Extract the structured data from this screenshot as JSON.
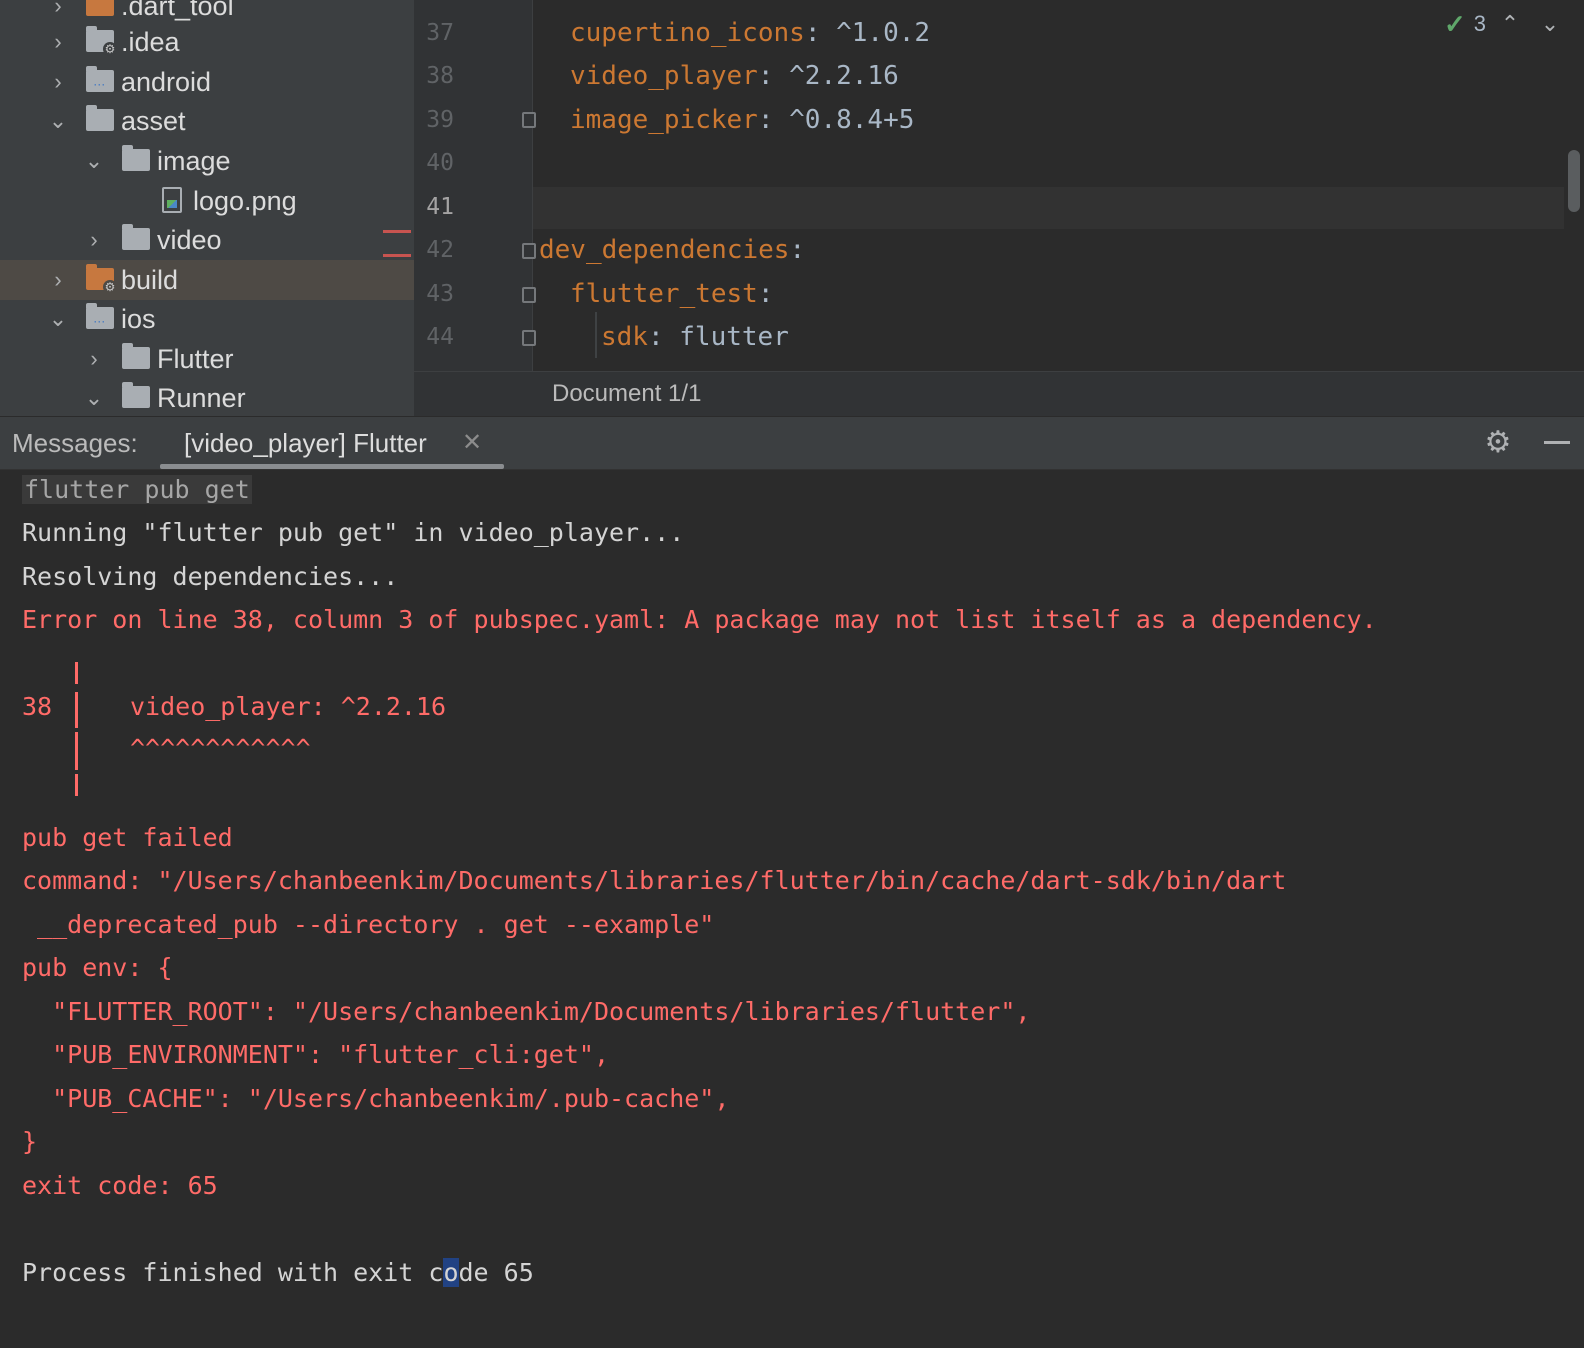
{
  "project_tree": [
    {
      "label": ".dart_tool",
      "chevron": "›",
      "depth": 0,
      "icon": "folder-orange"
    },
    {
      "label": ".idea",
      "chevron": "›",
      "depth": 0,
      "icon": "folder-settings"
    },
    {
      "label": "android",
      "chevron": "›",
      "depth": 0,
      "icon": "folder-module"
    },
    {
      "label": "asset",
      "chevron": "⌄",
      "depth": 0,
      "icon": "folder"
    },
    {
      "label": "image",
      "chevron": "⌄",
      "depth": 1,
      "icon": "folder"
    },
    {
      "label": "logo.png",
      "chevron": "",
      "depth": 2,
      "icon": "image-file"
    },
    {
      "label": "video",
      "chevron": "›",
      "depth": 1,
      "icon": "folder"
    },
    {
      "label": "build",
      "chevron": "›",
      "depth": 0,
      "icon": "folder-excluded"
    },
    {
      "label": "ios",
      "chevron": "⌄",
      "depth": 0,
      "icon": "folder-module"
    },
    {
      "label": "Flutter",
      "chevron": "›",
      "depth": 1,
      "icon": "folder"
    },
    {
      "label": "Runner",
      "chevron": "⌄",
      "depth": 1,
      "icon": "folder"
    }
  ],
  "editor": {
    "lines": [
      {
        "num": "37",
        "key": "cupertino_icons",
        "sep": ": ",
        "value": "^1.0.2"
      },
      {
        "num": "38",
        "key": "video_player",
        "sep": ": ",
        "value": "^2.2.16"
      },
      {
        "num": "39",
        "key": "image_picker",
        "sep": ": ",
        "value": "^0.8.4+5"
      },
      {
        "num": "40",
        "key": "",
        "sep": "",
        "value": ""
      },
      {
        "num": "41",
        "key": "",
        "sep": "",
        "value": ""
      },
      {
        "num": "42",
        "key": "dev_dependencies",
        "sep": ":",
        "value": ""
      },
      {
        "num": "43",
        "key": "flutter_test",
        "sep": ":",
        "value": ""
      },
      {
        "num": "44",
        "key": "sdk",
        "sep": ": ",
        "value": "flutter"
      }
    ],
    "inspection_count": "3",
    "breadcrumb": "Document 1/1"
  },
  "messages": {
    "title": "Messages:",
    "tab_label": "[video_player] Flutter",
    "close_glyph": "✕"
  },
  "console": {
    "command": "flutter pub get",
    "running": "Running \"flutter pub get\" in video_player...",
    "resolving": "Resolving dependencies...",
    "error": "Error on line 38, column 3 of pubspec.yaml: A package may not list itself as a dependency.",
    "snippet_line_no": "38",
    "snippet_code": "video_player: ^2.2.16",
    "snippet_carets": "^^^^^^^^^^^^",
    "failed": "pub get failed",
    "command_line1": "command: \"/Users/chanbeenkim/Documents/libraries/flutter/bin/cache/dart-sdk/bin/dart",
    "command_line2": " __deprecated_pub --directory . get --example\"",
    "env_open": "pub env: {",
    "env_flutter_root": "  \"FLUTTER_ROOT\": \"/Users/chanbeenkim/Documents/libraries/flutter\",",
    "env_pub_environment": "  \"PUB_ENVIRONMENT\": \"flutter_cli:get\",",
    "env_pub_cache": "  \"PUB_CACHE\": \"/Users/chanbeenkim/.pub-cache\",",
    "env_close": "}",
    "exit_code": "exit code: 65",
    "finished_pre": "Process finished with exit c",
    "finished_cursor": "o",
    "finished_post": "de 65"
  },
  "colors": {
    "keyword_orange": "#cc7832",
    "error_red": "#ff6b68",
    "panel_bg": "#3c3f41",
    "editor_bg": "#2b2b2b"
  }
}
